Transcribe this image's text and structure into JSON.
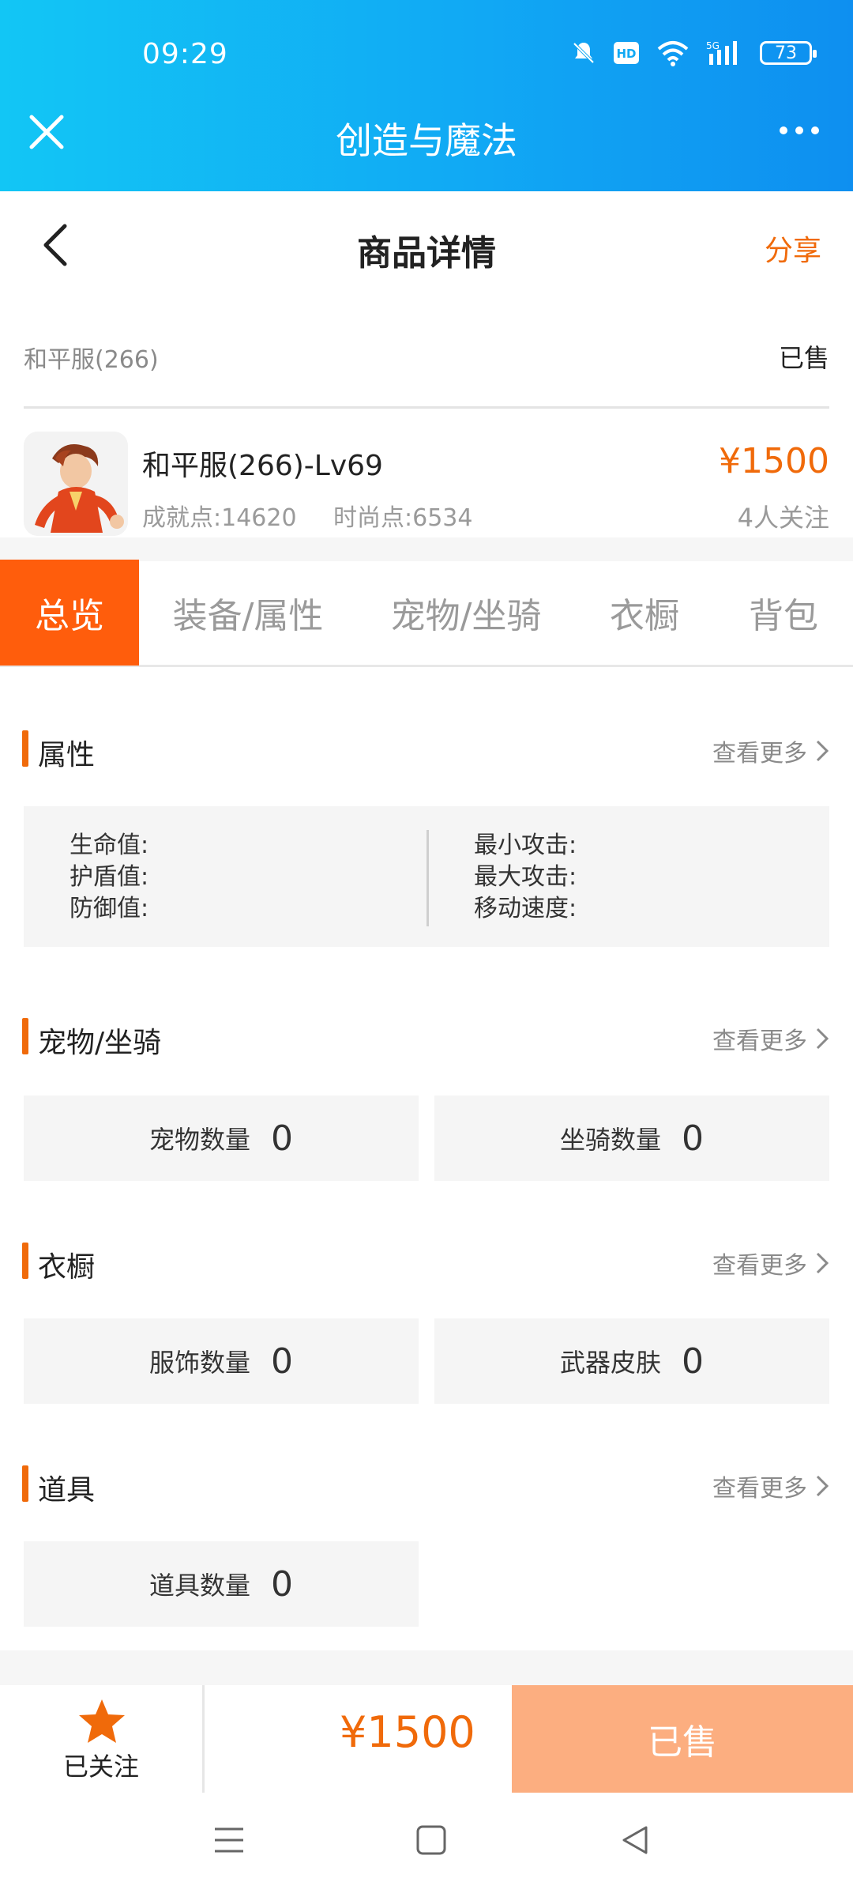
{
  "status_bar": {
    "time": "09:29",
    "battery": "73",
    "network": "5G"
  },
  "app_bar": {
    "title": "创造与魔法"
  },
  "header": {
    "title": "商品详情",
    "share_label": "分享"
  },
  "listing": {
    "server": "和平服(266)",
    "status": "已售",
    "name": "和平服(266)-Lv69",
    "achievement": "成就点:14620",
    "fashion": "时尚点:6534",
    "price": "¥1500",
    "watchers": "4人关注"
  },
  "tabs": [
    {
      "label": "总览"
    },
    {
      "label": "装备/属性"
    },
    {
      "label": "宠物/坐骑"
    },
    {
      "label": "衣橱"
    },
    {
      "label": "背包"
    }
  ],
  "sections": {
    "attributes": {
      "title": "属性",
      "more": "查看更多",
      "left": [
        "生命值:",
        "护盾值:",
        "防御值:"
      ],
      "right": [
        "最小攻击:",
        "最大攻击:",
        "移动速度:"
      ]
    },
    "pets": {
      "title": "宠物/坐骑",
      "more": "查看更多",
      "stats": [
        {
          "label": "宠物数量",
          "value": "0"
        },
        {
          "label": "坐骑数量",
          "value": "0"
        }
      ]
    },
    "wardrobe": {
      "title": "衣橱",
      "more": "查看更多",
      "stats": [
        {
          "label": "服饰数量",
          "value": "0"
        },
        {
          "label": "武器皮肤",
          "value": "0"
        }
      ]
    },
    "items": {
      "title": "道具",
      "more": "查看更多",
      "stats": [
        {
          "label": "道具数量",
          "value": "0"
        }
      ]
    }
  },
  "bottom_bar": {
    "follow_label": "已关注",
    "price": "¥1500",
    "sold_label": "已售"
  },
  "colors": {
    "accent": "#f06a0a",
    "tab_active": "#ff5d0c",
    "sold_button": "#fcae80",
    "topbar": "#11a9f4"
  }
}
